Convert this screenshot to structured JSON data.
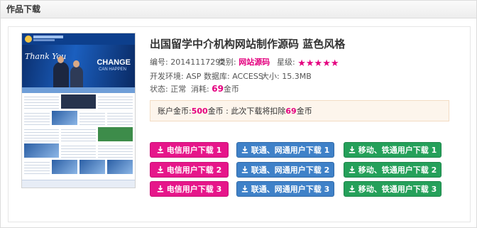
{
  "panel": {
    "title": "作品下载"
  },
  "thumbnail": {
    "script_text": "Thank You",
    "headline": "CHANGE",
    "subline": "CAN HAPPEN"
  },
  "product": {
    "title": "出国留学中介机构网站制作源码  蓝色风格",
    "id_label": "编号:",
    "id_value": "20141117292",
    "category_label": "类别:",
    "category_value": "网站源码",
    "rating_label": "星级:",
    "rating": 5,
    "env_label": "开发环境:",
    "env_value": "ASP",
    "db_label": "数据库:",
    "db_value": "ACCESS",
    "size_label": "大小:",
    "size_value": "15.3MB",
    "status_label": "状态:",
    "status_value": "正常",
    "cost_label": "消耗:",
    "cost_value": "69",
    "cost_unit": "金币"
  },
  "notice": {
    "prefix": "账户金币:",
    "balance": "500",
    "middle": "金币 : 此次下载将扣除",
    "deduct": "69",
    "suffix": "金币"
  },
  "buttons": {
    "telecom": [
      "电信用户下载 1",
      "电信用户下载 2",
      "电信用户下载 3"
    ],
    "unicom": [
      "联通、网通用户下载 1",
      "联通、网通用户下载 2",
      "联通、网通用户下载 3"
    ],
    "mobile": [
      "移动、铁通用户下载 1",
      "移动、铁通用户下载 2",
      "移动、铁通用户下载 3"
    ]
  },
  "colors": {
    "telecom": "#e6168a",
    "unicom": "#3f81c8",
    "mobile": "#25a05a",
    "accent": "#e4007f"
  },
  "icons": {
    "download": "download-icon",
    "star": "star-icon"
  }
}
